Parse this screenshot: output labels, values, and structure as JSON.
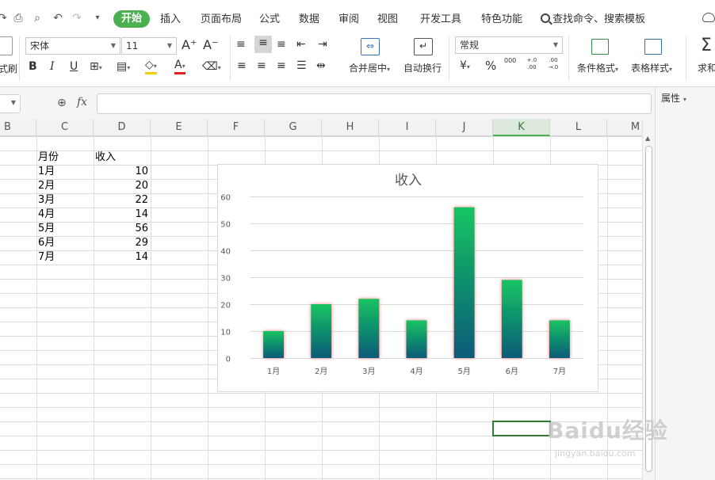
{
  "menu": {
    "tabs": [
      "开始",
      "插入",
      "页面布局",
      "公式",
      "数据",
      "审阅",
      "视图",
      "开发工具",
      "特色功能"
    ],
    "search_label": "查找命令、搜索模板"
  },
  "ribbon": {
    "font_name": "宋体",
    "font_size": "11",
    "number_format": "常规",
    "merge_center": "合并居中",
    "wrap_text": "自动换行",
    "cond_format": "条件格式",
    "table_style": "表格样式",
    "sum_label": "求和",
    "format_painter_partial": "式刷",
    "percent": "%",
    "thousands": "000",
    "inc_decimal": "+.0 .00",
    "dec_decimal": ".00 →.0",
    "bold": "B",
    "italic": "I",
    "underline": "U",
    "font_grow": "A⁺",
    "font_shrink": "A⁻",
    "font_color": "A"
  },
  "formula": {
    "fx": "fx",
    "value": ""
  },
  "right_pane": {
    "title": "属性"
  },
  "grid": {
    "columns": [
      "B",
      "C",
      "D",
      "E",
      "F",
      "G",
      "H",
      "I",
      "J",
      "K",
      "L",
      "M"
    ],
    "active_column": "K",
    "header_month": "月份",
    "header_income": "收入",
    "rows": [
      {
        "month": "1月",
        "income": "10"
      },
      {
        "month": "2月",
        "income": "20"
      },
      {
        "month": "3月",
        "income": "22"
      },
      {
        "month": "4月",
        "income": "14"
      },
      {
        "month": "5月",
        "income": "56"
      },
      {
        "month": "6月",
        "income": "29"
      },
      {
        "month": "7月",
        "income": "14"
      }
    ]
  },
  "chart_data": {
    "type": "bar",
    "title": "收入",
    "categories": [
      "1月",
      "2月",
      "3月",
      "4月",
      "5月",
      "6月",
      "7月"
    ],
    "values": [
      10,
      20,
      22,
      14,
      56,
      29,
      14
    ],
    "ylim": [
      0,
      60
    ],
    "yticks": [
      0,
      10,
      20,
      30,
      40,
      50,
      60
    ],
    "grid": true,
    "colors": {
      "bar_top": "#15c463",
      "bar_bottom": "#0a5a78",
      "glow": "#f08080",
      "grid": "#d9d9d9"
    }
  },
  "watermark": {
    "brand": "Baidu经验",
    "url": "jingyan.baidu.com"
  }
}
